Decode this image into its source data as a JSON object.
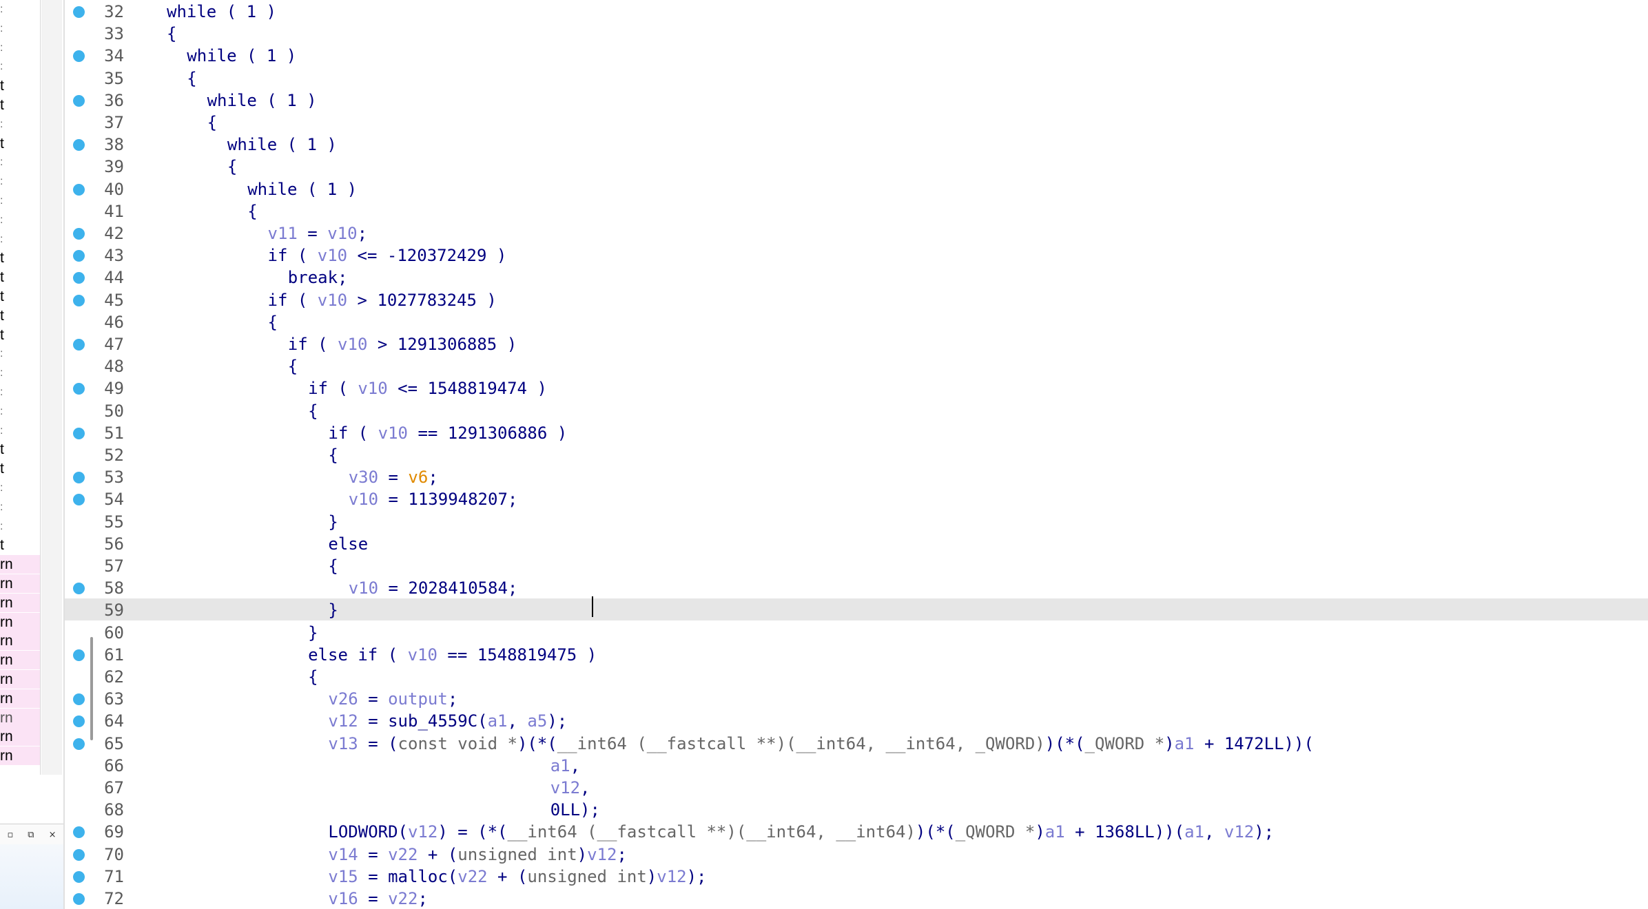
{
  "left_panel": {
    "rows": [
      {
        "text": ":",
        "style": "tick"
      },
      {
        "text": ":",
        "style": "tick"
      },
      {
        "text": ":",
        "style": "tick"
      },
      {
        "text": ":",
        "style": "tick"
      },
      {
        "text": "t",
        "style": ""
      },
      {
        "text": "t",
        "style": ""
      },
      {
        "text": ":",
        "style": "tick"
      },
      {
        "text": "t",
        "style": ""
      },
      {
        "text": ":",
        "style": "tick"
      },
      {
        "text": ":",
        "style": "tick"
      },
      {
        "text": ":",
        "style": "tick"
      },
      {
        "text": ":",
        "style": "tick"
      },
      {
        "text": ":",
        "style": "tick"
      },
      {
        "text": "t",
        "style": ""
      },
      {
        "text": "t",
        "style": ""
      },
      {
        "text": "t",
        "style": ""
      },
      {
        "text": "t",
        "style": ""
      },
      {
        "text": "t",
        "style": ""
      },
      {
        "text": ":",
        "style": "tick"
      },
      {
        "text": ":",
        "style": "tick"
      },
      {
        "text": ":",
        "style": "tick"
      },
      {
        "text": ":",
        "style": "tick"
      },
      {
        "text": ":",
        "style": "tick"
      },
      {
        "text": "t",
        "style": ""
      },
      {
        "text": "t",
        "style": ""
      },
      {
        "text": ":",
        "style": "tick"
      },
      {
        "text": ":",
        "style": "tick"
      },
      {
        "text": ":",
        "style": "tick"
      },
      {
        "text": "t",
        "style": ""
      },
      {
        "text": "rn",
        "style": "pink"
      },
      {
        "text": "rn",
        "style": "pink"
      },
      {
        "text": "rn",
        "style": "pink"
      },
      {
        "text": "rn",
        "style": "pink"
      },
      {
        "text": "rn",
        "style": "pink"
      },
      {
        "text": "rn",
        "style": "pink"
      },
      {
        "text": "rn",
        "style": "pink"
      },
      {
        "text": "rn",
        "style": "pink"
      },
      {
        "text": "rn",
        "style": "pink dim"
      },
      {
        "text": "rn",
        "style": "pink"
      },
      {
        "text": "rn",
        "style": "pink"
      }
    ],
    "controls": {
      "restore": "▫",
      "float": "⧉",
      "close": "×"
    }
  },
  "code": {
    "current_line": 59,
    "lines": [
      {
        "n": "32",
        "bp": true,
        "indent": 2,
        "tokens": [
          [
            "k",
            "while ( 1 )"
          ]
        ]
      },
      {
        "n": "33",
        "bp": false,
        "indent": 2,
        "tokens": [
          [
            "k",
            "{"
          ]
        ]
      },
      {
        "n": "34",
        "bp": true,
        "indent": 4,
        "tokens": [
          [
            "k",
            "while ( 1 )"
          ]
        ]
      },
      {
        "n": "35",
        "bp": false,
        "indent": 4,
        "tokens": [
          [
            "k",
            "{"
          ]
        ]
      },
      {
        "n": "36",
        "bp": true,
        "indent": 6,
        "tokens": [
          [
            "k",
            "while ( 1 )"
          ]
        ]
      },
      {
        "n": "37",
        "bp": false,
        "indent": 6,
        "tokens": [
          [
            "k",
            "{"
          ]
        ]
      },
      {
        "n": "38",
        "bp": true,
        "indent": 8,
        "tokens": [
          [
            "k",
            "while ( 1 )"
          ]
        ]
      },
      {
        "n": "39",
        "bp": false,
        "indent": 8,
        "tokens": [
          [
            "k",
            "{"
          ]
        ]
      },
      {
        "n": "40",
        "bp": true,
        "indent": 10,
        "tokens": [
          [
            "k",
            "while ( 1 )"
          ]
        ]
      },
      {
        "n": "41",
        "bp": false,
        "indent": 10,
        "tokens": [
          [
            "k",
            "{"
          ]
        ]
      },
      {
        "n": "42",
        "bp": true,
        "indent": 12,
        "tokens": [
          [
            "v",
            "v11"
          ],
          [
            "k",
            " = "
          ],
          [
            "v",
            "v10"
          ],
          [
            "k",
            ";"
          ]
        ]
      },
      {
        "n": "43",
        "bp": true,
        "indent": 12,
        "tokens": [
          [
            "k",
            "if ( "
          ],
          [
            "v",
            "v10"
          ],
          [
            "k",
            " <= -120372429 )"
          ]
        ]
      },
      {
        "n": "44",
        "bp": true,
        "indent": 14,
        "tokens": [
          [
            "k",
            "break;"
          ]
        ]
      },
      {
        "n": "45",
        "bp": true,
        "indent": 12,
        "tokens": [
          [
            "k",
            "if ( "
          ],
          [
            "v",
            "v10"
          ],
          [
            "k",
            " > 1027783245 )"
          ]
        ]
      },
      {
        "n": "46",
        "bp": false,
        "indent": 12,
        "tokens": [
          [
            "k",
            "{"
          ]
        ]
      },
      {
        "n": "47",
        "bp": true,
        "indent": 14,
        "tokens": [
          [
            "k",
            "if ( "
          ],
          [
            "v",
            "v10"
          ],
          [
            "k",
            " > 1291306885 )"
          ]
        ]
      },
      {
        "n": "48",
        "bp": false,
        "indent": 14,
        "tokens": [
          [
            "k",
            "{"
          ]
        ]
      },
      {
        "n": "49",
        "bp": true,
        "indent": 16,
        "tokens": [
          [
            "k",
            "if ( "
          ],
          [
            "v",
            "v10"
          ],
          [
            "k",
            " <= 1548819474 )"
          ]
        ]
      },
      {
        "n": "50",
        "bp": false,
        "indent": 16,
        "tokens": [
          [
            "k",
            "{"
          ]
        ]
      },
      {
        "n": "51",
        "bp": true,
        "indent": 18,
        "tokens": [
          [
            "k",
            "if ( "
          ],
          [
            "v",
            "v10"
          ],
          [
            "k",
            " == 1291306886 )"
          ]
        ]
      },
      {
        "n": "52",
        "bp": false,
        "indent": 18,
        "tokens": [
          [
            "k",
            "{"
          ]
        ]
      },
      {
        "n": "53",
        "bp": true,
        "indent": 20,
        "tokens": [
          [
            "v",
            "v30"
          ],
          [
            "k",
            " = "
          ],
          [
            "g",
            "v6"
          ],
          [
            "k",
            ";"
          ]
        ]
      },
      {
        "n": "54",
        "bp": true,
        "indent": 20,
        "tokens": [
          [
            "v",
            "v10"
          ],
          [
            "k",
            " = 1139948207;"
          ]
        ]
      },
      {
        "n": "55",
        "bp": false,
        "indent": 18,
        "tokens": [
          [
            "k",
            "}"
          ]
        ]
      },
      {
        "n": "56",
        "bp": false,
        "indent": 18,
        "tokens": [
          [
            "k",
            "else"
          ]
        ]
      },
      {
        "n": "57",
        "bp": false,
        "indent": 18,
        "tokens": [
          [
            "k",
            "{"
          ]
        ]
      },
      {
        "n": "58",
        "bp": true,
        "indent": 20,
        "tokens": [
          [
            "v",
            "v10"
          ],
          [
            "k",
            " = 2028410584;"
          ]
        ]
      },
      {
        "n": "59",
        "bp": false,
        "indent": 18,
        "tokens": [
          [
            "k",
            "}"
          ]
        ]
      },
      {
        "n": "60",
        "bp": false,
        "indent": 16,
        "tokens": [
          [
            "k",
            "}"
          ]
        ]
      },
      {
        "n": "61",
        "bp": true,
        "indent": 16,
        "tokens": [
          [
            "k",
            "else if ( "
          ],
          [
            "v",
            "v10"
          ],
          [
            "k",
            " == 1548819475 )"
          ]
        ]
      },
      {
        "n": "62",
        "bp": false,
        "indent": 16,
        "tokens": [
          [
            "k",
            "{"
          ]
        ]
      },
      {
        "n": "63",
        "bp": true,
        "indent": 18,
        "tokens": [
          [
            "v",
            "v26"
          ],
          [
            "k",
            " = "
          ],
          [
            "v",
            "output"
          ],
          [
            "k",
            ";"
          ]
        ]
      },
      {
        "n": "64",
        "bp": true,
        "indent": 18,
        "tokens": [
          [
            "v",
            "v12"
          ],
          [
            "k",
            " = sub_4559C("
          ],
          [
            "v",
            "a1"
          ],
          [
            "k",
            ", "
          ],
          [
            "v",
            "a5"
          ],
          [
            "k",
            ");"
          ]
        ]
      },
      {
        "n": "65",
        "bp": true,
        "indent": 18,
        "tokens": [
          [
            "v",
            "v13"
          ],
          [
            "k",
            " = ("
          ],
          [
            "t",
            "const void *"
          ],
          [
            "k",
            ")(*("
          ],
          [
            "t",
            "__int64 (__fastcall **)(__int64, __int64, _QWORD)"
          ],
          [
            "k",
            ")(*("
          ],
          [
            "t",
            "_QWORD *"
          ],
          [
            "k",
            ")"
          ],
          [
            "v",
            "a1"
          ],
          [
            "k",
            " + 1472LL))("
          ]
        ]
      },
      {
        "n": "66",
        "bp": false,
        "indent": 40,
        "tokens": [
          [
            "v",
            "a1"
          ],
          [
            "k",
            ","
          ]
        ]
      },
      {
        "n": "67",
        "bp": false,
        "indent": 40,
        "tokens": [
          [
            "v",
            "v12"
          ],
          [
            "k",
            ","
          ]
        ]
      },
      {
        "n": "68",
        "bp": false,
        "indent": 40,
        "tokens": [
          [
            "k",
            "0LL);"
          ]
        ]
      },
      {
        "n": "69",
        "bp": true,
        "indent": 18,
        "tokens": [
          [
            "k",
            "LODWORD("
          ],
          [
            "v",
            "v12"
          ],
          [
            "k",
            ") = (*("
          ],
          [
            "t",
            "__int64 (__fastcall **)(__int64, __int64)"
          ],
          [
            "k",
            ")(*("
          ],
          [
            "t",
            "_QWORD *"
          ],
          [
            "k",
            ")"
          ],
          [
            "v",
            "a1"
          ],
          [
            "k",
            " + 1368LL))("
          ],
          [
            "v",
            "a1"
          ],
          [
            "k",
            ", "
          ],
          [
            "v",
            "v12"
          ],
          [
            "k",
            ");"
          ]
        ]
      },
      {
        "n": "70",
        "bp": true,
        "indent": 18,
        "tokens": [
          [
            "v",
            "v14"
          ],
          [
            "k",
            " = "
          ],
          [
            "v",
            "v22"
          ],
          [
            "k",
            " + ("
          ],
          [
            "t",
            "unsigned int"
          ],
          [
            "k",
            ")"
          ],
          [
            "v",
            "v12"
          ],
          [
            "k",
            ";"
          ]
        ]
      },
      {
        "n": "71",
        "bp": true,
        "indent": 18,
        "tokens": [
          [
            "v",
            "v15"
          ],
          [
            "k",
            " = malloc("
          ],
          [
            "v",
            "v22"
          ],
          [
            "k",
            " + ("
          ],
          [
            "t",
            "unsigned int"
          ],
          [
            "k",
            ")"
          ],
          [
            "v",
            "v12"
          ],
          [
            "k",
            ");"
          ]
        ]
      },
      {
        "n": "72",
        "bp": true,
        "indent": 18,
        "tokens": [
          [
            "v",
            "v16"
          ],
          [
            "k",
            " = "
          ],
          [
            "v",
            "v22"
          ],
          [
            "k",
            ";"
          ]
        ]
      }
    ]
  }
}
